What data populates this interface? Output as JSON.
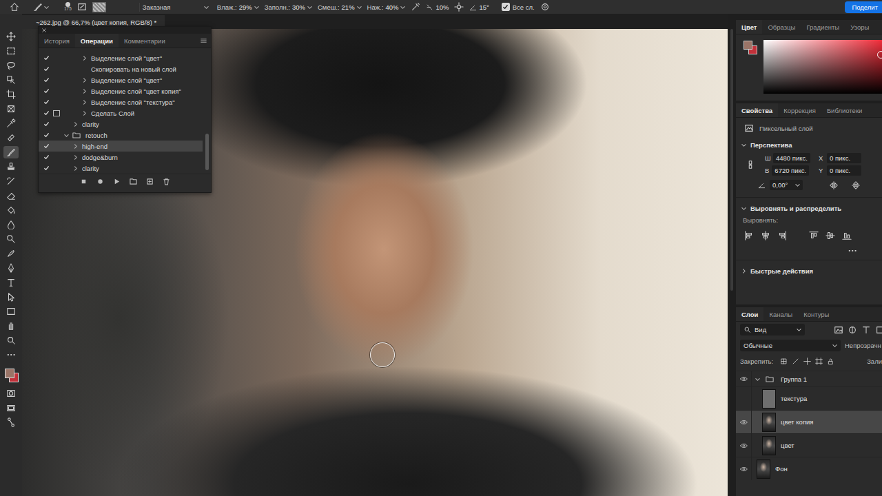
{
  "options_bar": {
    "brush_size": "175",
    "preset": "Заказная",
    "fields": [
      {
        "label": "Влаж.:",
        "value": "29%"
      },
      {
        "label": "Заполн.:",
        "value": "30%"
      },
      {
        "label": "Смеш.:",
        "value": "21%"
      },
      {
        "label": "Наж.:",
        "value": "40%"
      }
    ],
    "flow": "10%",
    "angle": "15°",
    "sample_all": {
      "label": "Все сл.",
      "checked": true
    },
    "share_button": "Поделит"
  },
  "document_tab": {
    "title": "~262.jpg @ 66,7% (цвет копия, RGB/8) *",
    "selected": true
  },
  "colors": {
    "foreground": "#9a7467",
    "background": "#c1313a"
  },
  "toolbar": {
    "tools": [
      {
        "selected": false
      },
      {
        "selected": false
      },
      {
        "selected": false
      },
      {
        "selected": false
      },
      {
        "selected": false
      },
      {
        "selected": false
      },
      {
        "selected": false
      },
      {
        "selected": false
      },
      {
        "selected": true
      },
      {
        "selected": false
      },
      {
        "selected": false
      },
      {
        "selected": false
      },
      {
        "selected": false
      },
      {
        "selected": false
      },
      {
        "selected": false
      },
      {
        "selected": false
      },
      {
        "selected": false
      },
      {
        "selected": false
      },
      {
        "selected": false
      },
      {
        "selected": false
      },
      {
        "selected": false
      },
      {
        "selected": false
      }
    ]
  },
  "canvas": {
    "scroll": {
      "start": 0,
      "size": 0.56
    }
  },
  "actions_panel": {
    "tabs": [
      {
        "label": "История",
        "selected": false
      },
      {
        "label": "Операции",
        "selected": true
      },
      {
        "label": "Комментарии",
        "selected": false
      }
    ],
    "rows": [
      {
        "label": "Выделение слой \"цвет\"",
        "kind": "step",
        "checked": true,
        "dialog": false,
        "expandable": true,
        "expanded": false,
        "selected": false
      },
      {
        "label": "Скопировать на новый слой",
        "kind": "step",
        "checked": true,
        "dialog": false,
        "expandable": false,
        "expanded": false,
        "selected": false
      },
      {
        "label": "Выделение слой \"цвет\"",
        "kind": "step",
        "checked": true,
        "dialog": false,
        "expandable": true,
        "expanded": false,
        "selected": false
      },
      {
        "label": "Выделение слой \"цвет копия\"",
        "kind": "step",
        "checked": true,
        "dialog": false,
        "expandable": true,
        "expanded": false,
        "selected": false
      },
      {
        "label": "Выделение слой \"текстура\"",
        "kind": "step",
        "checked": true,
        "dialog": false,
        "expandable": true,
        "expanded": false,
        "selected": false
      },
      {
        "label": "Сделать Слой",
        "kind": "step",
        "checked": true,
        "dialog": true,
        "expandable": true,
        "expanded": false,
        "selected": false
      },
      {
        "label": "clarity",
        "kind": "action",
        "checked": true,
        "dialog": false,
        "expandable": true,
        "expanded": false,
        "selected": false
      },
      {
        "label": "retouch",
        "kind": "set",
        "checked": true,
        "dialog": false,
        "expandable": true,
        "expanded": true,
        "selected": false
      },
      {
        "label": "high-end",
        "kind": "action",
        "checked": true,
        "dialog": false,
        "expandable": true,
        "expanded": false,
        "selected": true
      },
      {
        "label": "dodge&burn",
        "kind": "action",
        "checked": true,
        "dialog": false,
        "expandable": true,
        "expanded": false,
        "selected": false
      },
      {
        "label": "clarity",
        "kind": "action",
        "checked": true,
        "dialog": false,
        "expandable": true,
        "expanded": false,
        "selected": false
      }
    ],
    "scroll": {
      "start": 0.68,
      "size": 0.3
    }
  },
  "color_panel": {
    "tabs": [
      {
        "label": "Цвет",
        "selected": true
      },
      {
        "label": "Образцы",
        "selected": false
      },
      {
        "label": "Градиенты",
        "selected": false
      },
      {
        "label": "Узоры",
        "selected": false
      }
    ],
    "hue": "#f02d3a"
  },
  "properties_panel": {
    "tabs": [
      {
        "label": "Свойства",
        "selected": true
      },
      {
        "label": "Коррекция",
        "selected": false
      },
      {
        "label": "Библиотеки",
        "selected": false
      }
    ],
    "layer_type": "Пиксельный слой",
    "transform": {
      "title": "Перспектива",
      "expanded": true,
      "fields": [
        {
          "label": "Ш",
          "value": "4480 пикс."
        },
        {
          "label": "X",
          "value": "0 пикс."
        },
        {
          "label": "В",
          "value": "6720 пикс."
        },
        {
          "label": "Y",
          "value": "0 пикс."
        }
      ],
      "angle": "0,00°"
    },
    "align": {
      "title": "Выровнять и распределить",
      "expanded": true,
      "label": "Выровнять:"
    },
    "quick_actions": {
      "title": "Быстрые действия",
      "expanded": false
    }
  },
  "layers_panel": {
    "tabs": [
      {
        "label": "Слои",
        "selected": true
      },
      {
        "label": "Каналы",
        "selected": false
      },
      {
        "label": "Контуры",
        "selected": false
      }
    ],
    "filter": "Вид",
    "blend_mode": "Обычные",
    "opacity_label": "Непрозрачн",
    "lock_label": "Закрепить:",
    "fill_label": "Зали",
    "layers": [
      {
        "name": "Группа 1",
        "kind": "group",
        "visible": true,
        "expanded": true,
        "selected": false
      },
      {
        "name": "текстура",
        "kind": "texture",
        "visible": false,
        "expanded": false,
        "selected": false
      },
      {
        "name": "цвет копия",
        "kind": "photo",
        "visible": true,
        "expanded": false,
        "selected": true
      },
      {
        "name": "цвет",
        "kind": "photo",
        "visible": true,
        "expanded": false,
        "selected": false
      },
      {
        "name": "Фон",
        "kind": "background",
        "visible": true,
        "expanded": false,
        "selected": false
      }
    ]
  }
}
